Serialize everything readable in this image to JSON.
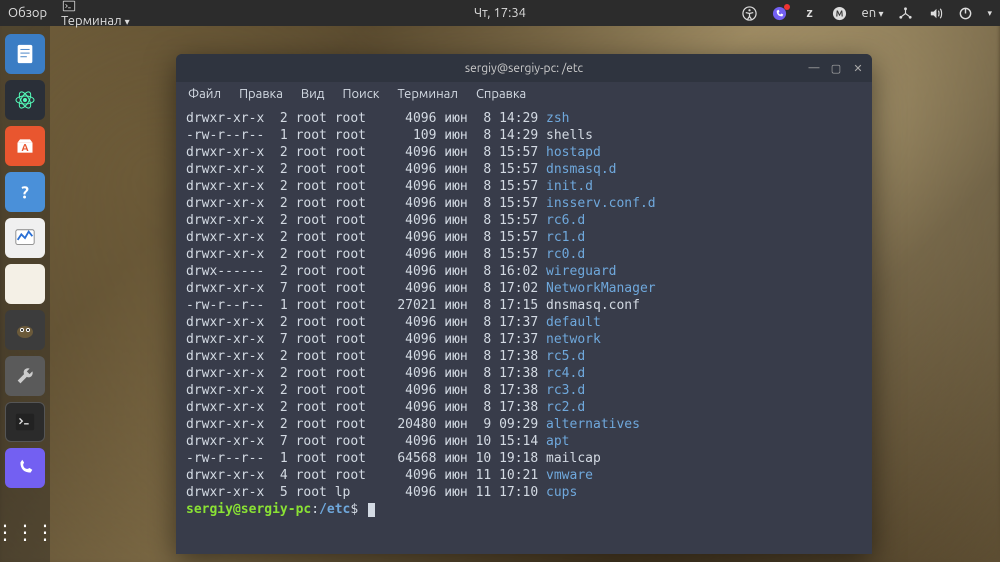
{
  "topbar": {
    "overview": "Обзор",
    "app_indicator": "Терминал",
    "clock": "Чт, 17:34",
    "lang": "en"
  },
  "terminal": {
    "title": "sergiy@sergiy-pc: /etc",
    "menu": [
      "Файл",
      "Правка",
      "Вид",
      "Поиск",
      "Терминал",
      "Справка"
    ],
    "prompt": {
      "user_host": "sergiy@sergiy-pc",
      "sep": ":",
      "path": "/etc",
      "sym": "$"
    },
    "listing": [
      {
        "perm": "drwxr-xr-x",
        "n": "2",
        "u": "root",
        "g": "root",
        "size": "4096",
        "mon": "июн",
        "day": "8",
        "time": "14:29",
        "name": "zsh",
        "dir": true
      },
      {
        "perm": "-rw-r--r--",
        "n": "1",
        "u": "root",
        "g": "root",
        "size": "109",
        "mon": "июн",
        "day": "8",
        "time": "14:29",
        "name": "shells",
        "dir": false
      },
      {
        "perm": "drwxr-xr-x",
        "n": "2",
        "u": "root",
        "g": "root",
        "size": "4096",
        "mon": "июн",
        "day": "8",
        "time": "15:57",
        "name": "hostapd",
        "dir": true
      },
      {
        "perm": "drwxr-xr-x",
        "n": "2",
        "u": "root",
        "g": "root",
        "size": "4096",
        "mon": "июн",
        "day": "8",
        "time": "15:57",
        "name": "dnsmasq.d",
        "dir": true
      },
      {
        "perm": "drwxr-xr-x",
        "n": "2",
        "u": "root",
        "g": "root",
        "size": "4096",
        "mon": "июн",
        "day": "8",
        "time": "15:57",
        "name": "init.d",
        "dir": true
      },
      {
        "perm": "drwxr-xr-x",
        "n": "2",
        "u": "root",
        "g": "root",
        "size": "4096",
        "mon": "июн",
        "day": "8",
        "time": "15:57",
        "name": "insserv.conf.d",
        "dir": true
      },
      {
        "perm": "drwxr-xr-x",
        "n": "2",
        "u": "root",
        "g": "root",
        "size": "4096",
        "mon": "июн",
        "day": "8",
        "time": "15:57",
        "name": "rc6.d",
        "dir": true
      },
      {
        "perm": "drwxr-xr-x",
        "n": "2",
        "u": "root",
        "g": "root",
        "size": "4096",
        "mon": "июн",
        "day": "8",
        "time": "15:57",
        "name": "rc1.d",
        "dir": true
      },
      {
        "perm": "drwxr-xr-x",
        "n": "2",
        "u": "root",
        "g": "root",
        "size": "4096",
        "mon": "июн",
        "day": "8",
        "time": "15:57",
        "name": "rc0.d",
        "dir": true
      },
      {
        "perm": "drwx------",
        "n": "2",
        "u": "root",
        "g": "root",
        "size": "4096",
        "mon": "июн",
        "day": "8",
        "time": "16:02",
        "name": "wireguard",
        "dir": true
      },
      {
        "perm": "drwxr-xr-x",
        "n": "7",
        "u": "root",
        "g": "root",
        "size": "4096",
        "mon": "июн",
        "day": "8",
        "time": "17:02",
        "name": "NetworkManager",
        "dir": true
      },
      {
        "perm": "-rw-r--r--",
        "n": "1",
        "u": "root",
        "g": "root",
        "size": "27021",
        "mon": "июн",
        "day": "8",
        "time": "17:15",
        "name": "dnsmasq.conf",
        "dir": false
      },
      {
        "perm": "drwxr-xr-x",
        "n": "2",
        "u": "root",
        "g": "root",
        "size": "4096",
        "mon": "июн",
        "day": "8",
        "time": "17:37",
        "name": "default",
        "dir": true
      },
      {
        "perm": "drwxr-xr-x",
        "n": "7",
        "u": "root",
        "g": "root",
        "size": "4096",
        "mon": "июн",
        "day": "8",
        "time": "17:37",
        "name": "network",
        "dir": true
      },
      {
        "perm": "drwxr-xr-x",
        "n": "2",
        "u": "root",
        "g": "root",
        "size": "4096",
        "mon": "июн",
        "day": "8",
        "time": "17:38",
        "name": "rc5.d",
        "dir": true
      },
      {
        "perm": "drwxr-xr-x",
        "n": "2",
        "u": "root",
        "g": "root",
        "size": "4096",
        "mon": "июн",
        "day": "8",
        "time": "17:38",
        "name": "rc4.d",
        "dir": true
      },
      {
        "perm": "drwxr-xr-x",
        "n": "2",
        "u": "root",
        "g": "root",
        "size": "4096",
        "mon": "июн",
        "day": "8",
        "time": "17:38",
        "name": "rc3.d",
        "dir": true
      },
      {
        "perm": "drwxr-xr-x",
        "n": "2",
        "u": "root",
        "g": "root",
        "size": "4096",
        "mon": "июн",
        "day": "8",
        "time": "17:38",
        "name": "rc2.d",
        "dir": true
      },
      {
        "perm": "drwxr-xr-x",
        "n": "2",
        "u": "root",
        "g": "root",
        "size": "20480",
        "mon": "июн",
        "day": "9",
        "time": "09:29",
        "name": "alternatives",
        "dir": true
      },
      {
        "perm": "drwxr-xr-x",
        "n": "7",
        "u": "root",
        "g": "root",
        "size": "4096",
        "mon": "июн",
        "day": "10",
        "time": "15:14",
        "name": "apt",
        "dir": true
      },
      {
        "perm": "-rw-r--r--",
        "n": "1",
        "u": "root",
        "g": "root",
        "size": "64568",
        "mon": "июн",
        "day": "10",
        "time": "19:18",
        "name": "mailcap",
        "dir": false
      },
      {
        "perm": "drwxr-xr-x",
        "n": "4",
        "u": "root",
        "g": "root",
        "size": "4096",
        "mon": "июн",
        "day": "11",
        "time": "10:21",
        "name": "vmware",
        "dir": true
      },
      {
        "perm": "drwxr-xr-x",
        "n": "5",
        "u": "root",
        "g": "lp",
        "size": "4096",
        "mon": "июн",
        "day": "11",
        "time": "17:10",
        "name": "cups",
        "dir": true
      }
    ]
  }
}
